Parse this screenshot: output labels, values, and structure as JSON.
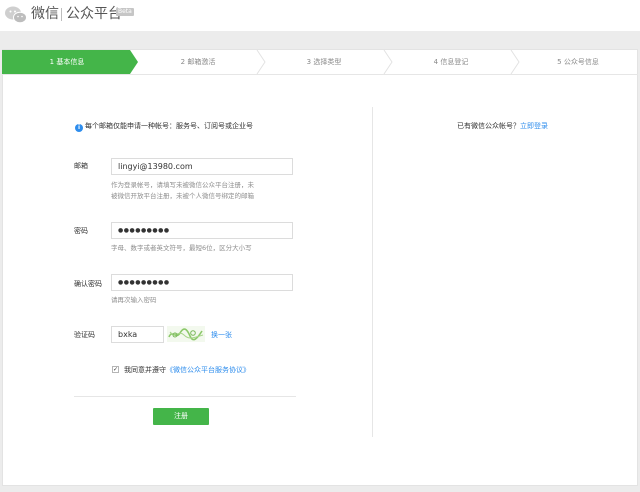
{
  "header": {
    "brand": "微信",
    "platform": "公众平台",
    "beta": "Beta"
  },
  "steps": [
    {
      "label": "1 基本信息",
      "active": true
    },
    {
      "label": "2 邮箱激活",
      "active": false
    },
    {
      "label": "3 选择类型",
      "active": false
    },
    {
      "label": "4 信息登记",
      "active": false
    },
    {
      "label": "5 公众号信息",
      "active": false
    }
  ],
  "notice": "每个邮箱仅能申请一种帐号：服务号、订阅号或企业号",
  "form": {
    "email_label": "邮箱",
    "email_value": "lingyi@13980.com",
    "email_hint_1": "作为登录帐号，请填写未被微信公众平台注册，未",
    "email_hint_2": "被微信开放平台注册，未被个人微信号绑定的邮箱",
    "password_label": "密码",
    "password_value": "●●●●●●●●●",
    "password_hint": "字母、数字或者英文符号，最短6位，区分大小写",
    "confirm_label": "确认密码",
    "confirm_value": "●●●●●●●●●",
    "confirm_hint": "请再次输入密码",
    "captcha_label": "验证码",
    "captcha_value": "bxka",
    "captcha_refresh": "换一张",
    "agree_checked": "✓",
    "agree_text": "我同意并遵守",
    "agree_link": "《微信公众平台服务协议》",
    "submit": "注册"
  },
  "side": {
    "prompt": "已有微信公众帐号？",
    "login_link": "立即登录"
  },
  "colors": {
    "accent_green": "#44b549",
    "link_blue": "#2e8ded"
  }
}
